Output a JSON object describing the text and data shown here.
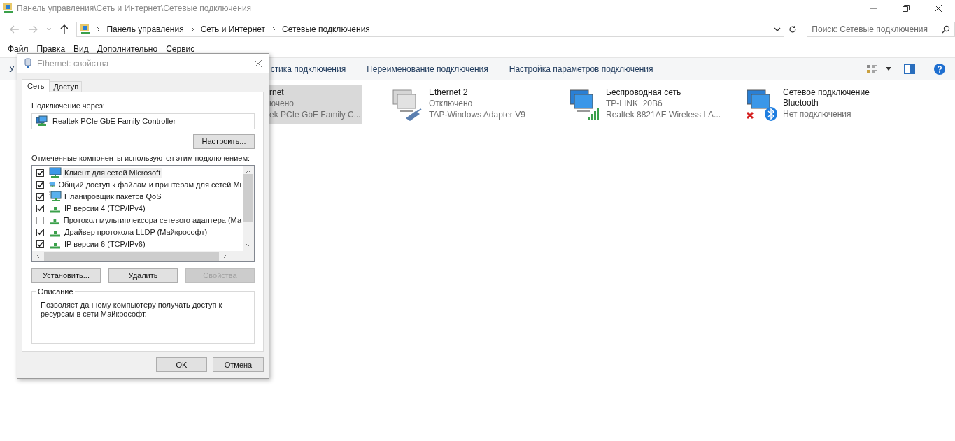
{
  "window": {
    "title": "Панель управления\\Сеть и Интернет\\Сетевые подключения"
  },
  "address_bar": {
    "path": [
      "Панель управления",
      "Сеть и Интернет",
      "Сетевые подключения"
    ]
  },
  "search": {
    "placeholder": "Поиск: Сетевые подключения"
  },
  "menu": [
    "Файл",
    "Правка",
    "Вид",
    "Дополнительно",
    "Сервис"
  ],
  "toolbar": [
    "У",
    "стика подключения",
    "Переименование подключения",
    "Настройка параметров подключения"
  ],
  "connections": [
    {
      "name": "rnet",
      "status": "ючено",
      "adapter": "ek PCIe GbE Family C...",
      "kind": "cut",
      "selected": true
    },
    {
      "name": "Ethernet 2",
      "status": "Отключено",
      "adapter": "TAP-Windows Adapter V9",
      "kind": "adapter",
      "selected": false
    },
    {
      "name": "Беспроводная сеть",
      "status": "TP-LINK_20B6",
      "adapter": "Realtek 8821AE Wireless LA...",
      "kind": "wifi",
      "selected": false
    },
    {
      "name": "Сетевое подключение Bluetooth",
      "status": "Нет подключения",
      "kind": "bluetooth",
      "selected": false
    }
  ],
  "dialog": {
    "title": "Ethernet: свойства",
    "tabs": [
      {
        "label": "Сеть",
        "selected": true
      },
      {
        "label": "Доступ",
        "selected": false
      }
    ],
    "connect_label": "Подключение через:",
    "adapter": "Realtek PCIe GbE Family Controller",
    "configure_button": "Настроить...",
    "components_label": "Отмеченные компоненты используются этим подключением:",
    "components": [
      {
        "label": "Клиент для сетей Microsoft",
        "checked": true,
        "selected": true,
        "kind": "client"
      },
      {
        "label": "Общий доступ к файлам и принтерам для сетей Mi",
        "checked": true,
        "selected": false,
        "kind": "service"
      },
      {
        "label": "Планировщик пакетов QoS",
        "checked": true,
        "selected": false,
        "kind": "service"
      },
      {
        "label": "IP версии 4 (TCP/IPv4)",
        "checked": true,
        "selected": false,
        "kind": "protocol"
      },
      {
        "label": "Протокол мультиплексора сетевого адаптера (Ма",
        "checked": false,
        "selected": false,
        "kind": "protocol"
      },
      {
        "label": "Драйвер протокола LLDP (Майкрософт)",
        "checked": true,
        "selected": false,
        "kind": "protocol"
      },
      {
        "label": "IP версии 6 (TCP/IPv6)",
        "checked": true,
        "selected": false,
        "kind": "protocol"
      }
    ],
    "buttons": [
      {
        "label": "Установить...",
        "disabled": false
      },
      {
        "label": "Удалить",
        "disabled": false
      },
      {
        "label": "Свойства",
        "disabled": true
      }
    ],
    "description_label": "Описание",
    "description": "Позволяет данному компьютеру получать доступ к ресурсам в сети Майкрософт.",
    "footer_buttons": [
      "OK",
      "Отмена"
    ]
  }
}
